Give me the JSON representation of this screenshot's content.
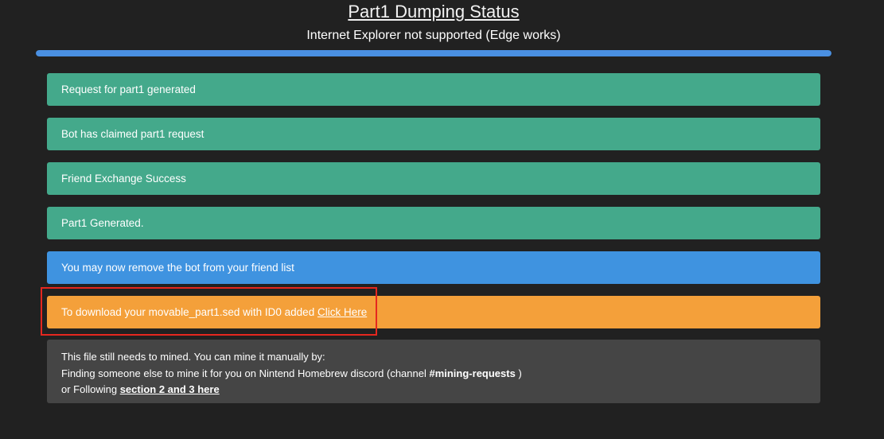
{
  "page": {
    "title": "Part1 Dumping Status",
    "subtitle": "Internet Explorer not supported (Edge works)",
    "progress_percent": 100
  },
  "statuses": [
    "Request for part1 generated",
    "Bot has claimed part1 request",
    "Friend Exchange Success",
    "Part1 Generated.",
    "You may now remove the bot from your friend list"
  ],
  "download": {
    "text": "To download your movable_part1.sed with ID0 added ",
    "link_label": "Click Here"
  },
  "note": {
    "line1": "This file still needs to mined. You can mine it manually by:",
    "line2_prefix": "Finding someone else to mine it for you on Nintend Homebrew discord (channel ",
    "channel": "#mining-requests",
    "line2_suffix": " )",
    "line3_prefix": "or Following ",
    "line3_link": "section 2 and 3 here"
  },
  "colors": {
    "success": "#44a98b",
    "info": "#3f93e0",
    "warning": "#f4a03a",
    "progress": "#4a90e2",
    "highlight": "#e5271f"
  }
}
